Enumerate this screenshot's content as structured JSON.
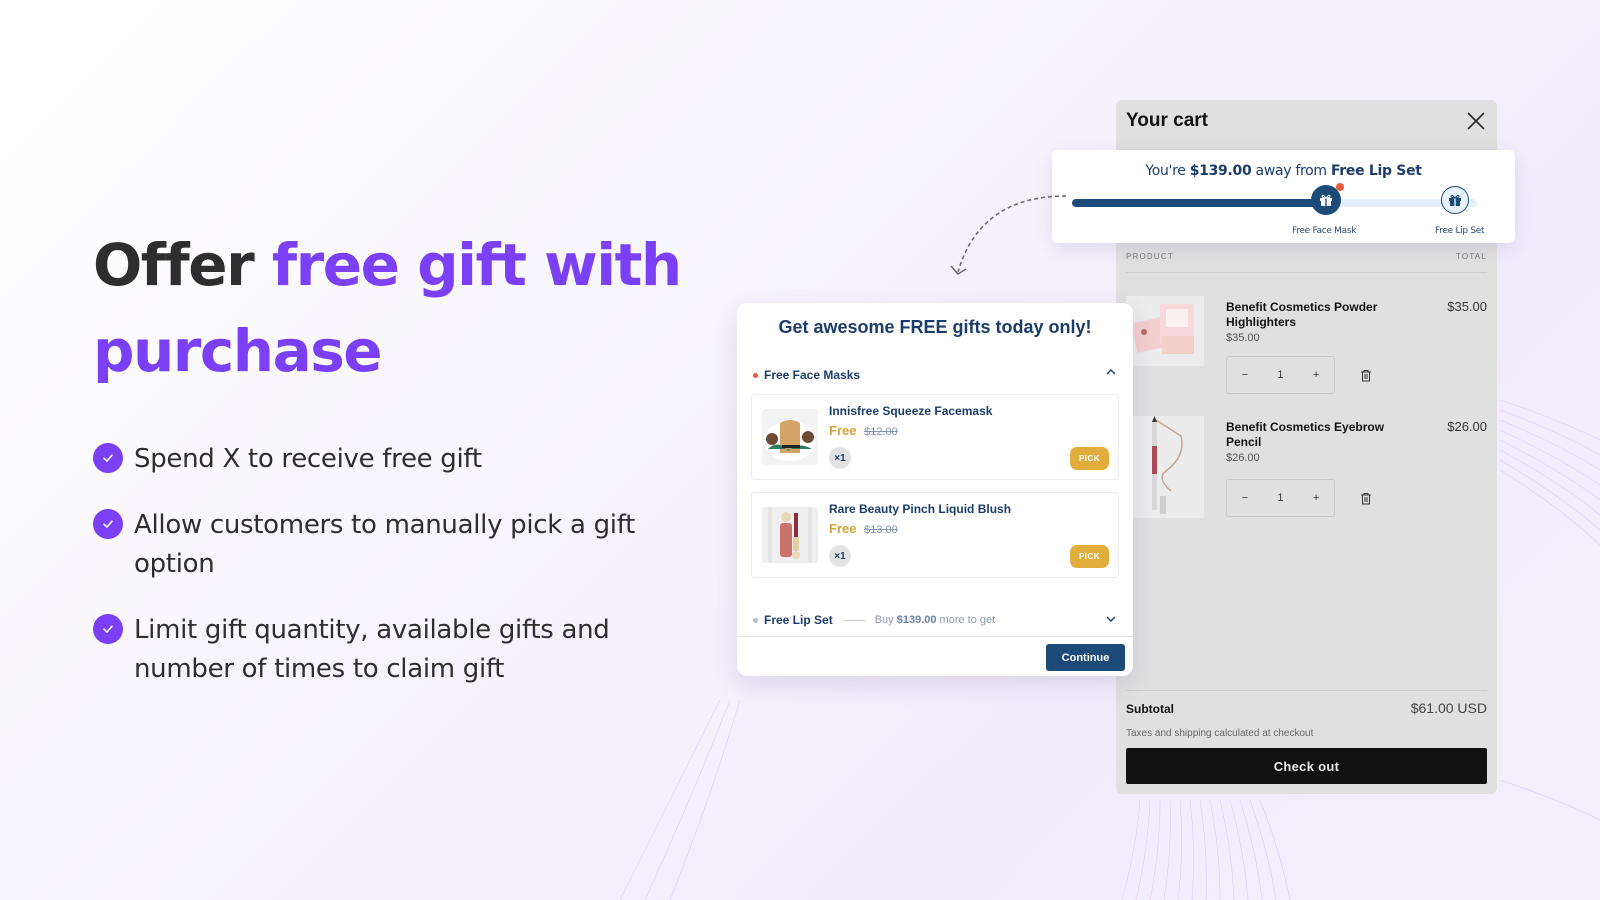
{
  "hero": {
    "title_prefix": "Offer",
    "title_accent": "free gift with purchase",
    "accent_color": "#7b40f6",
    "features": [
      "Spend X to receive free gift",
      "Allow customers to manually pick a gift option",
      "Limit gift quantity, available gifts and number of times to claim gift"
    ]
  },
  "progress": {
    "msg_prefix": "You're",
    "amount": "$139.00",
    "msg_mid": "away from",
    "target": "Free Lip Set",
    "progress_fraction": 0.61,
    "milestones": [
      {
        "label": "Free Face Mask",
        "reached": true,
        "icon": "gift-icon"
      },
      {
        "label": "Free Lip Set",
        "reached": false,
        "icon": "gift-icon"
      }
    ],
    "fill_color": "#1c4b7a"
  },
  "cart": {
    "title": "Your cart",
    "col_product": "PRODUCT",
    "col_total": "TOTAL",
    "items": [
      {
        "name": "Benefit Cosmetics Powder Highlighters",
        "price": "$35.00",
        "total": "$35.00",
        "qty": "1"
      },
      {
        "name": "Benefit Cosmetics Eyebrow Pencil",
        "price": "$26.00",
        "total": "$26.00",
        "qty": "1"
      }
    ],
    "minus": "−",
    "plus": "+",
    "subtotal_label": "Subtotal",
    "subtotal_value": "$61.00 USD",
    "tax_note": "Taxes and shipping calculated at checkout",
    "checkout_label": "Check out"
  },
  "gift_popup": {
    "title": "Get awesome FREE gifts today only!",
    "group1": {
      "name": "Free Face Masks",
      "dot_color": "#ef5a3a",
      "gifts": [
        {
          "name": "Innisfree Squeeze Facemask",
          "free": "Free",
          "orig_price": "$12.00",
          "qty": "×1",
          "pick": "PICK"
        },
        {
          "name": "Rare Beauty Pinch Liquid Blush",
          "free": "Free",
          "orig_price": "$13.00",
          "qty": "×1",
          "pick": "PICK"
        }
      ]
    },
    "group2": {
      "name": "Free Lip Set",
      "hint_prefix": "Buy",
      "hint_amount": "$139.00",
      "hint_suffix": "more to get"
    },
    "continue_label": "Continue"
  }
}
